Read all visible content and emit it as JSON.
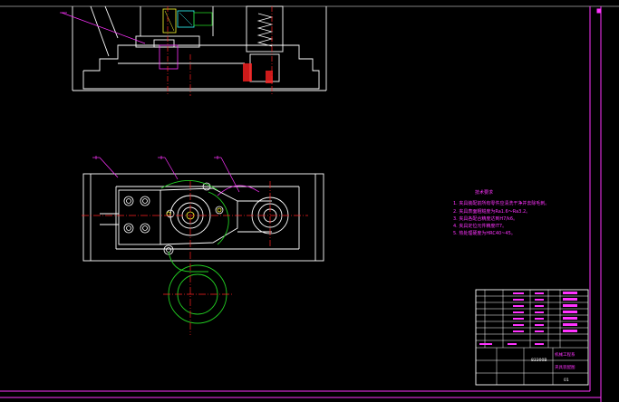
{
  "drawing": {
    "background": "#000000",
    "colors": {
      "frame": "#ff33ff",
      "outline": "#ffffff",
      "center_line": "#ff2020",
      "leader": "#ff33ff",
      "dimension": "#ff33ff",
      "arm": "#22cc22",
      "yellow_part": "#ffff33",
      "cyan_part": "#33ffff",
      "green_part": "#22cc22"
    },
    "technical_requirements": {
      "title": "技术要求",
      "items": [
        "1. 夹具装配前所有零件应清洗干净并去除毛刺。",
        "2. 夹具表面粗糙度为Ra1.6～Ra3.2。",
        "3. 夹具各配合精度达到H7/k6。",
        "4. 夹具定位元件精度IT7。",
        "5. 热处理硬度为HRC40~45。"
      ]
    },
    "title_block": {
      "drawing_number": "83300B",
      "institution": "机械工程系",
      "drawing_name": "夹具装配图",
      "sheet": "01"
    }
  }
}
